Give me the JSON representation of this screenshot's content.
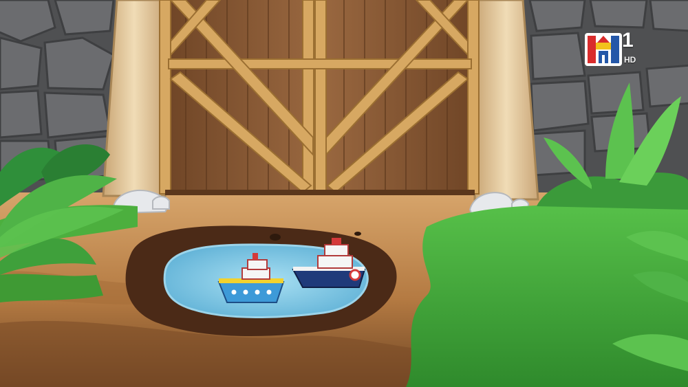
{
  "scene": {
    "description_tags": [
      "barn-door",
      "stone-wall",
      "puddle",
      "toy-boats",
      "grass",
      "jungle-leaves"
    ]
  },
  "logo": {
    "channel_number": "1",
    "quality_badge": "HD"
  },
  "colors": {
    "wall": "#5a5a5c",
    "door_plank": "#8a5a33",
    "door_beam": "#d7a862",
    "pillar": "#e6cfa5",
    "ground": "#c79257",
    "puddle_water": "#7ec6e6",
    "puddle_mud": "#4b2a17",
    "grass": "#3fa639",
    "leaf": "#4fb347",
    "logo_red": "#d92c2c",
    "logo_yellow": "#f2c21b",
    "logo_blue": "#2457a8"
  }
}
